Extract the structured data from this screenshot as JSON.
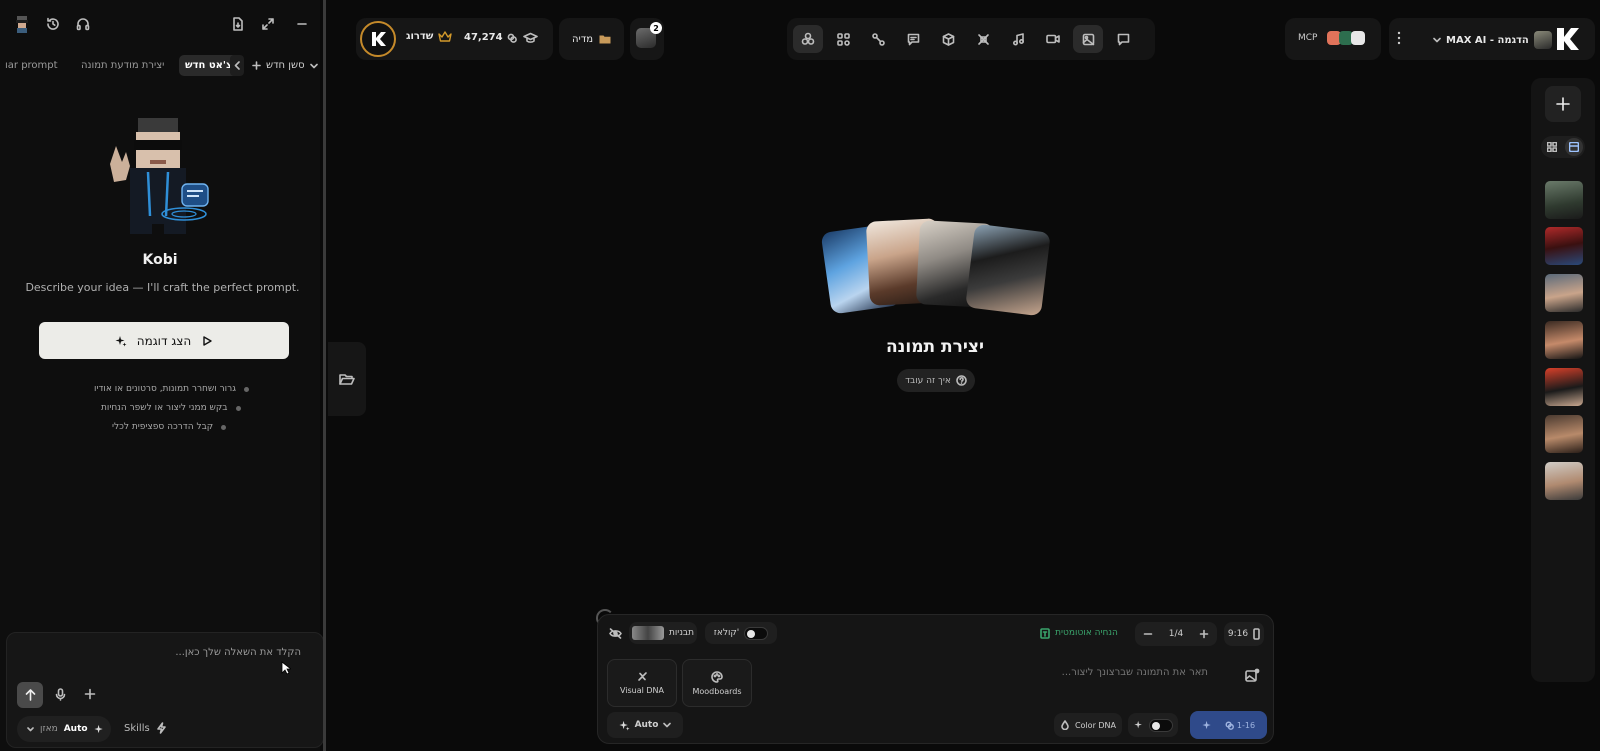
{
  "left_panel": {
    "tabs": {
      "new_session": "סשן חדש",
      "new_chat": "צ'אט חדש",
      "image_prompt": "יצירת מודעת תמונה",
      "other_prompt": "ıar prompt"
    },
    "assistant": {
      "name": "Kobi",
      "description": "Describe your idea — I'll craft the perfect prompt."
    },
    "demo_button": "הצג דוגמה",
    "bullets": [
      "גרור ושחרר תמונות, סרטונים או אודיו",
      "בקש ממני ליצור או לשפר הנחיות",
      "קבל הדרכה ספציפית לכלי"
    ],
    "chat": {
      "placeholder": "הקלד את השאלה שלך כאן...",
      "mode_label": "Auto",
      "mode_sub": "מאזן",
      "skills_label": "Skills"
    }
  },
  "header": {
    "credits": "47,274",
    "upgrade_label": "שדרוג",
    "media_label": "מדיה",
    "notification_count": "2",
    "mcp_label": "MCP",
    "workspace_label": "MAX AI - הדגמה"
  },
  "center": {
    "title": "יצירת תמונה",
    "how_it_works": "איך זה עובד"
  },
  "composer": {
    "presets_label": "תבניות",
    "collage_label": "קולאז'",
    "auto_prompt_label": "הנחיה אוטומטית",
    "count": "1/4",
    "ratio": "9:16",
    "prompt_placeholder": "תאר את התמונה שברצונך ליצור...",
    "visual_dna": "Visual DNA",
    "moodboards": "Moodboards",
    "model_label": "Auto",
    "color_dna": "Color DNA",
    "generate_cost": "1-16"
  },
  "colors": {
    "accent_blue": "#2f4a8a",
    "gold": "#d39a2b",
    "toggle_green": "#2d6e4e"
  }
}
